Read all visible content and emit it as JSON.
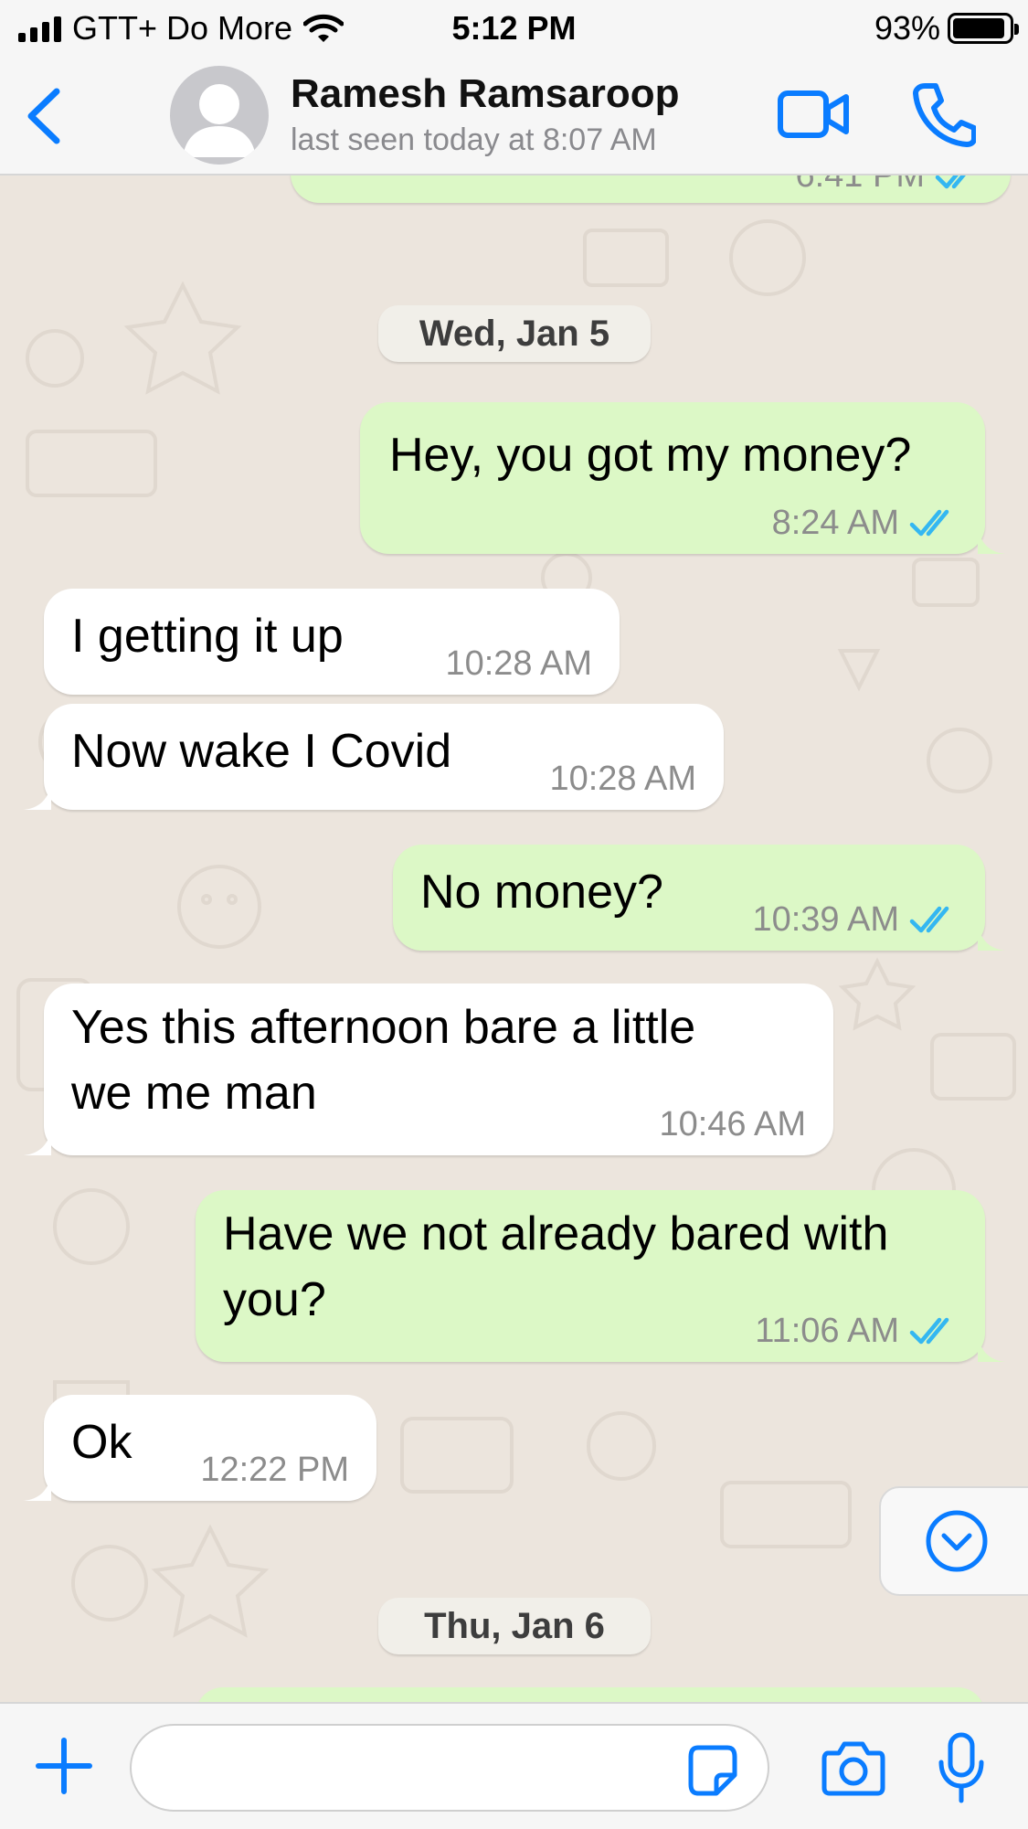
{
  "status_bar": {
    "carrier": "GTT+ Do More",
    "time": "5:12 PM",
    "battery": "93%",
    "battery_level": 0.93,
    "icons": [
      "signal-icon",
      "wifi-icon",
      "battery-icon"
    ]
  },
  "header": {
    "contact_name": "Ramesh Ramsaroop",
    "last_seen": "last seen today at 8:07 AM",
    "icons": [
      "back-chevron-icon",
      "avatar-placeholder-icon",
      "video-camera-icon",
      "phone-icon"
    ]
  },
  "chat": {
    "previous_message_time": "6:41 PM",
    "date_divider_1": "Wed, Jan 5",
    "date_divider_2": "Thu, Jan 6",
    "messages": [
      {
        "direction": "out",
        "text": "Hey, you got my money?",
        "time": "8:24 AM",
        "read": true
      },
      {
        "direction": "in",
        "text": "I getting it up",
        "time": "10:28 AM"
      },
      {
        "direction": "in",
        "text": "Now wake I Covid",
        "time": "10:28 AM"
      },
      {
        "direction": "out",
        "text": "No money?",
        "time": "10:39 AM",
        "read": true
      },
      {
        "direction": "in",
        "lines": [
          "Yes this afternoon bare a little",
          "we me man"
        ],
        "time": "10:46 AM"
      },
      {
        "direction": "out",
        "lines": [
          "Have we not already bared with",
          "you?"
        ],
        "time": "11:06 AM",
        "read": true
      },
      {
        "direction": "in",
        "text": "Ok",
        "time": "12:22 PM"
      }
    ]
  },
  "input_bar": {
    "placeholder": "",
    "icons": [
      "plus-icon",
      "sticker-icon",
      "camera-icon",
      "microphone-icon"
    ]
  },
  "colors": {
    "outgoing_bubble": "#dcf8c6",
    "incoming_bubble": "#ffffff",
    "accent_blue": "#0a7cff",
    "read_tick_blue": "#34b7f1",
    "chat_background": "#ece5dd"
  }
}
